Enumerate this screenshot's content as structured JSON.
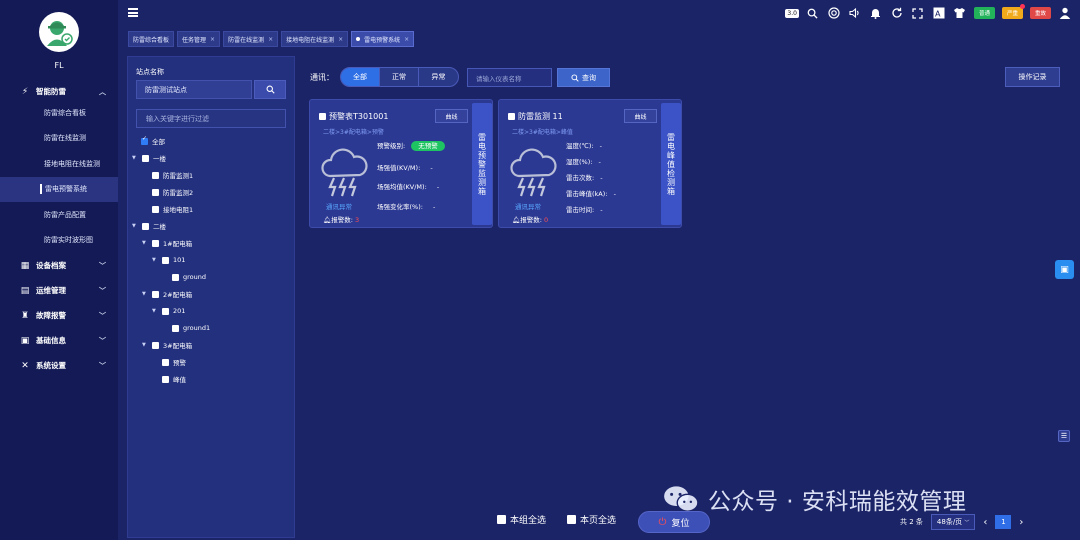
{
  "user": {
    "name": "FL"
  },
  "sidebar": {
    "groups": [
      {
        "label": "智能防雷",
        "icon": "lightning-shield-icon",
        "chev": "^",
        "items": [
          "防雷综合看板",
          "防雷在线监测",
          "接地电阻在线监测",
          "雷电预警系统",
          "防雷产品配置",
          "防雷实时波形图"
        ]
      },
      {
        "label": "设备档案",
        "icon": "grid-icon",
        "chev": "v"
      },
      {
        "label": "运维管理",
        "icon": "monitor-icon",
        "chev": "v"
      },
      {
        "label": "故障报警",
        "icon": "alarm-icon",
        "chev": "v"
      },
      {
        "label": "基础信息",
        "icon": "document-icon",
        "chev": "v"
      },
      {
        "label": "系统设置",
        "icon": "tools-icon",
        "chev": "v"
      }
    ],
    "active_item": "雷电预警系统"
  },
  "topbar": {
    "version": "3.0",
    "badges": [
      "普通",
      "严重",
      "重故"
    ]
  },
  "tabs": [
    {
      "label": "防雷综合看板",
      "closable": false
    },
    {
      "label": "任务管理",
      "closable": true
    },
    {
      "label": "防雷在线监测",
      "closable": true
    },
    {
      "label": "接地电阻在线监测",
      "closable": true
    },
    {
      "label": "雷电预警系统",
      "closable": true,
      "active": true
    }
  ],
  "left_panel": {
    "site_label": "站点名称",
    "site_value": "防雷测试站点",
    "filter_placeholder": "输入关键字进行过滤",
    "tree": [
      {
        "label": "全部",
        "checked": true
      },
      {
        "label": "一楼"
      },
      {
        "label": "防雷监测1"
      },
      {
        "label": "防雷监测2"
      },
      {
        "label": "接地电阻1"
      },
      {
        "label": "二楼"
      },
      {
        "label": "1#配电箱"
      },
      {
        "label": "101"
      },
      {
        "label": "ground"
      },
      {
        "label": "2#配电箱"
      },
      {
        "label": "201"
      },
      {
        "label": "ground1"
      },
      {
        "label": "3#配电箱"
      },
      {
        "label": "预警"
      },
      {
        "label": "峰值"
      }
    ]
  },
  "filter": {
    "comm_label": "通讯：",
    "options": [
      "全部",
      "正常",
      "异常"
    ],
    "selected": "全部",
    "search_placeholder": "请输入仪表名称",
    "query_label": "查询",
    "oplog_label": "操作记录"
  },
  "cards": [
    {
      "title": "预警表T301001",
      "path": "二楼>3#配电箱>预警",
      "curve_label": "曲线",
      "side_label": "雷电预警监测箱",
      "comm_status": "通讯异常",
      "alarm_label": "报警数:",
      "alarm_count": "3",
      "fields": [
        {
          "label": "预警级别:",
          "value": "无预警"
        },
        {
          "label": "场强值(KV/M):",
          "value": "-"
        },
        {
          "label": "场强均值(KV/M):",
          "value": "-"
        },
        {
          "label": "场强变化率(%):",
          "value": "-"
        }
      ]
    },
    {
      "title": "防雷监测 11",
      "path": "二楼>3#配电箱>峰值",
      "curve_label": "曲线",
      "side_label": "雷电峰值检测箱",
      "comm_status": "通讯异常",
      "alarm_label": "报警数:",
      "alarm_count": "0",
      "fields": [
        {
          "label": "温度(℃):",
          "value": "-"
        },
        {
          "label": "湿度(%):",
          "value": "-"
        },
        {
          "label": "雷击次数:",
          "value": "-"
        },
        {
          "label": "雷击峰值(kA):",
          "value": "-"
        },
        {
          "label": "雷击时间:",
          "value": "-"
        }
      ]
    }
  ],
  "bottom": {
    "select_group": "本组全选",
    "select_page": "本页全选",
    "reset": "复位",
    "total": "共 2 条",
    "page_size": "48条/页",
    "page": "1",
    "prev": "‹",
    "next": "›"
  },
  "watermark": {
    "text": "公众号 · 安科瑞能效管理"
  }
}
